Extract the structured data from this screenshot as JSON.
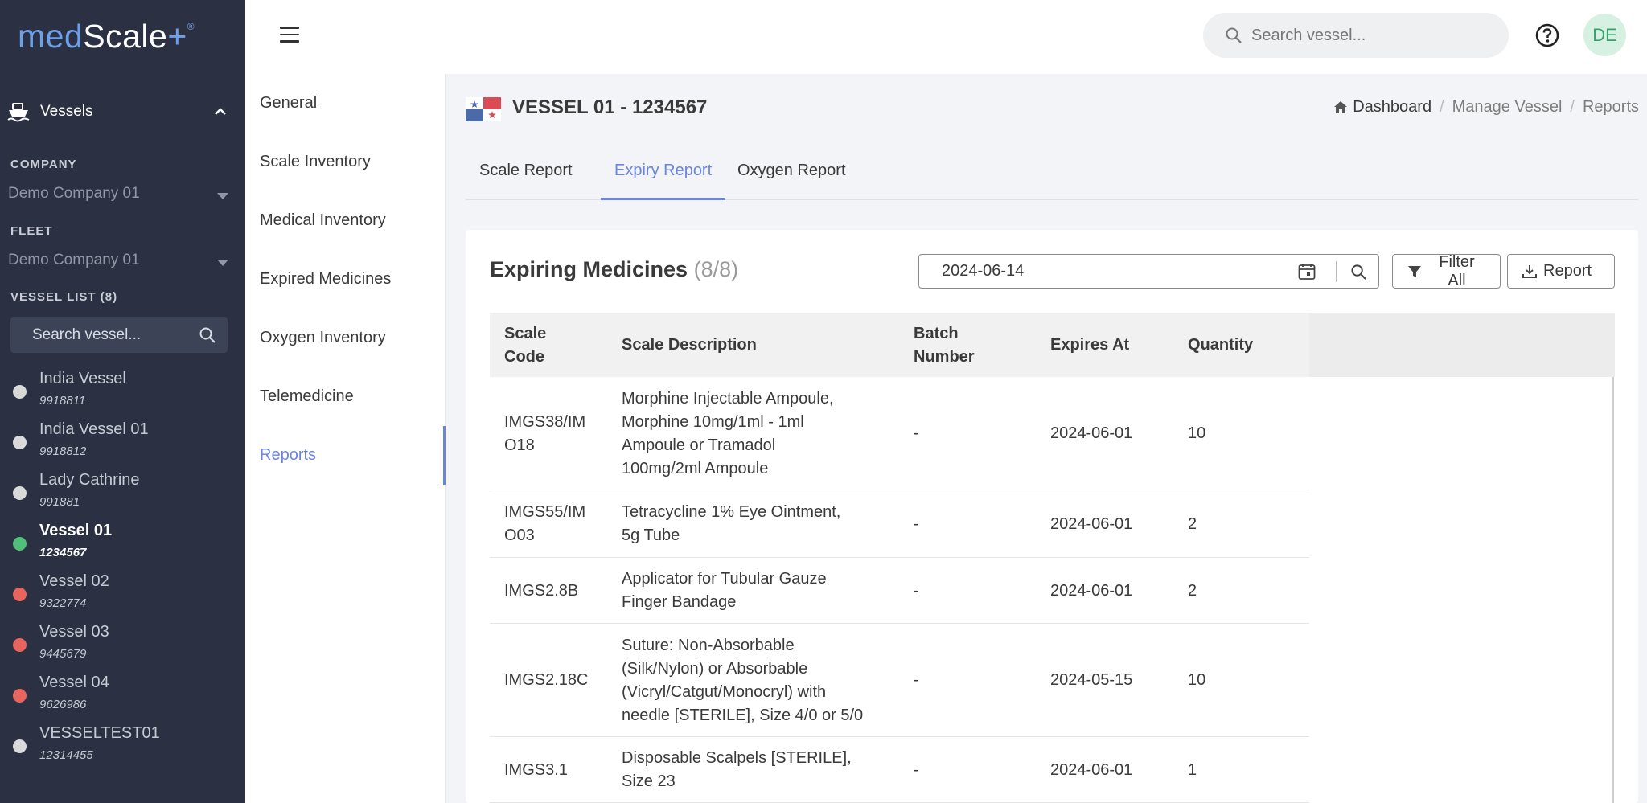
{
  "logo": {
    "med": "med",
    "scale": "Scale",
    "plus": "+",
    "mark": "®"
  },
  "sidebar": {
    "vessels_label": "Vessels",
    "company_label": "COMPANY",
    "company_value": "Demo Company 01",
    "fleet_label": "FLEET",
    "fleet_value": "Demo Company 01",
    "vessel_list_label": "VESSEL LIST (8)",
    "search_placeholder": "Search vessel...",
    "vessels": [
      {
        "name": "India Vessel",
        "id": "9918811",
        "status_color": "#d9d9d9",
        "active": false
      },
      {
        "name": "India Vessel 01",
        "id": "9918812",
        "status_color": "#d9d9d9",
        "active": false
      },
      {
        "name": "Lady Cathrine",
        "id": "991881",
        "status_color": "#d9d9d9",
        "active": false
      },
      {
        "name": "Vessel 01",
        "id": "1234567",
        "status_color": "#4fbf7a",
        "active": true
      },
      {
        "name": "Vessel 02",
        "id": "9322774",
        "status_color": "#e8655d",
        "active": false
      },
      {
        "name": "Vessel 03",
        "id": "9445679",
        "status_color": "#e8655d",
        "active": false
      },
      {
        "name": "Vessel 04",
        "id": "9626986",
        "status_color": "#e8655d",
        "active": false
      },
      {
        "name": "VESSELTEST01",
        "id": "12314455",
        "status_color": "#d9d9d9",
        "active": false
      }
    ]
  },
  "header": {
    "search_placeholder": "Search vessel...",
    "avatar_initials": "DE"
  },
  "submenu": {
    "items": [
      "General",
      "Scale Inventory",
      "Medical Inventory",
      "Expired Medicines",
      "Oxygen Inventory",
      "Telemedicine",
      "Reports"
    ],
    "active": "Reports"
  },
  "page": {
    "vessel_title": "VESSEL 01 - 1234567",
    "breadcrumb": [
      "Dashboard",
      "Manage Vessel",
      "Reports"
    ],
    "tabs": [
      "Scale Report",
      "Expiry Report",
      "Oxygen Report"
    ],
    "active_tab": "Expiry Report"
  },
  "card": {
    "title": "Expiring Medicines",
    "count": "(8/8)",
    "date_value": "2024-06-14",
    "filter_label": "Filter All",
    "report_label": "Report"
  },
  "table": {
    "headers": [
      "Scale\nCode",
      "Scale Description",
      "Batch\nNumber",
      "Expires At",
      "Quantity"
    ],
    "rows": [
      {
        "code": "IMGS38/IM\nO18",
        "desc": "Morphine Injectable Ampoule,\nMorphine 10mg/1ml - 1ml\nAmpoule or Tramadol\n100mg/2ml Ampoule",
        "batch": "-",
        "expires": "2024-06-01",
        "qty": "10"
      },
      {
        "code": "IMGS55/IM\nO03",
        "desc": "Tetracycline 1% Eye Ointment,\n5g Tube",
        "batch": "-",
        "expires": "2024-06-01",
        "qty": "2"
      },
      {
        "code": "IMGS2.8B",
        "desc": "Applicator for Tubular Gauze\nFinger Bandage",
        "batch": "-",
        "expires": "2024-06-01",
        "qty": "2"
      },
      {
        "code": "IMGS2.18C",
        "desc": "Suture: Non-Absorbable\n(Silk/Nylon) or Absorbable\n(Vicryl/Catgut/Monocryl) with\nneedle [STERILE], Size 4/0 or 5/0",
        "batch": "-",
        "expires": "2024-05-15",
        "qty": "10"
      },
      {
        "code": "IMGS3.1",
        "desc": "Disposable Scalpels [STERILE],\nSize 23",
        "batch": "-",
        "expires": "2024-06-01",
        "qty": "1"
      }
    ]
  },
  "colors": {
    "accent": "#6c85dc",
    "sidebar_bg": "#2b3142",
    "active_status": "#4fbf7a",
    "expired_status": "#e8655d"
  }
}
